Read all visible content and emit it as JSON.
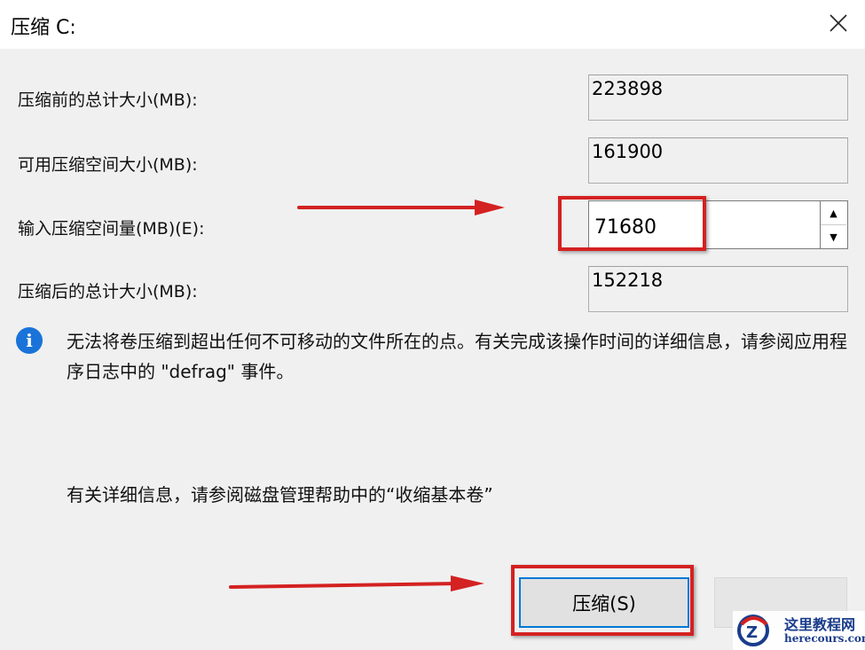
{
  "window": {
    "title": "压缩 C:",
    "close_icon": "close-icon"
  },
  "fields": {
    "total_before": {
      "label": "压缩前的总计大小(MB):",
      "value": "223898"
    },
    "available": {
      "label": "可用压缩空间大小(MB):",
      "value": "161900"
    },
    "shrink_amount": {
      "label": "输入压缩空间量(MB)(E):",
      "value": "71680"
    },
    "total_after": {
      "label": "压缩后的总计大小(MB):",
      "value": "152218"
    }
  },
  "info": {
    "icon": "info-icon",
    "glyph": "i",
    "text": "无法将卷压缩到超出任何不可移动的文件所在的点。有关完成该操作时间的详细信息，请参阅应用程序日志中的 \"defrag\" 事件。"
  },
  "help_text": "有关详细信息，请参阅磁盘管理帮助中的“收缩基本卷”",
  "buttons": {
    "shrink": "压缩(S)"
  },
  "spinner": {
    "up": "▲",
    "down": "▼"
  },
  "annotations": {
    "highlight_color": "#d42121"
  },
  "watermark": {
    "title": "这里教程网",
    "url": "herecours.com"
  }
}
